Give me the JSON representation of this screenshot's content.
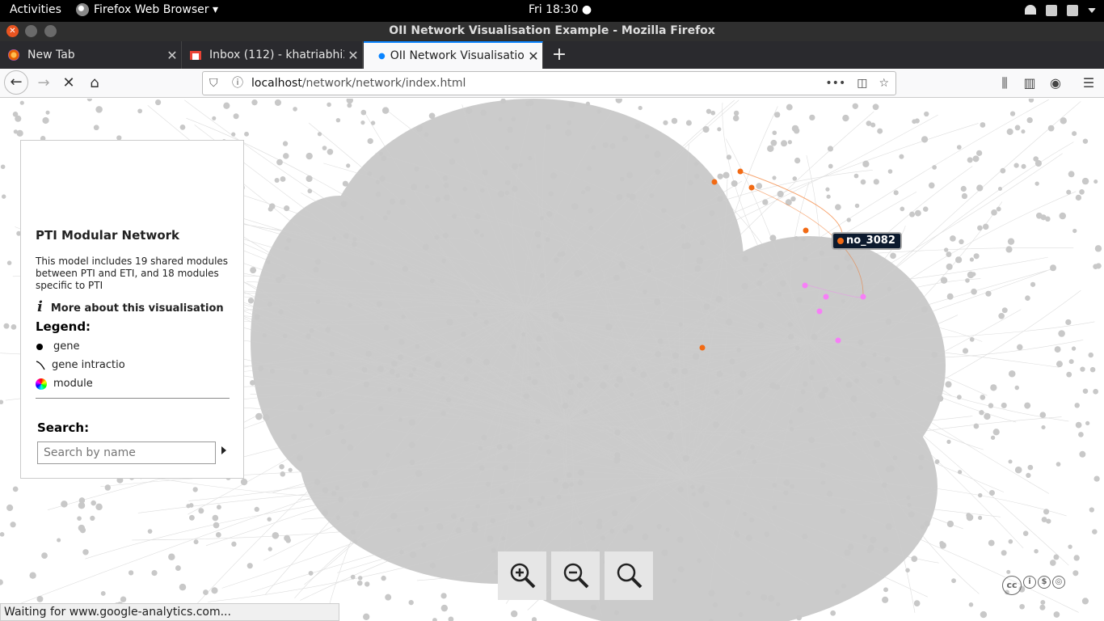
{
  "topbar": {
    "activities": "Activities",
    "app": "Firefox Web Browser ▾",
    "clock": "Fri 18:30 ●"
  },
  "window": {
    "title": "OII Network Visualisation Example - Mozilla Firefox"
  },
  "tabs": [
    {
      "label": "New Tab"
    },
    {
      "label": "Inbox (112) - khatriabhi2"
    },
    {
      "label": "OII Network Visualisatio"
    }
  ],
  "url": {
    "host": "localhost",
    "path": "/network/network/index.html"
  },
  "panel": {
    "title": "PTI Modular Network",
    "description": "This model includes 19 shared modules between PTI and ETI, and 18 modules specific to PTI",
    "more": "More about this visualisation",
    "legend_title": "Legend:",
    "legend": [
      {
        "label": "gene"
      },
      {
        "label": "gene intractio"
      },
      {
        "label": "module"
      }
    ],
    "search_title": "Search:",
    "search_placeholder": "Search by name"
  },
  "tooltip": {
    "label": "no_3082"
  },
  "status": "Waiting for www.google-analytics.com...",
  "colors": {
    "highlight_orange": "#f26a14",
    "highlight_pink": "#f77ff7",
    "node_gray": "#c8c8c8"
  },
  "icons": [
    "zoom-in-icon",
    "zoom-out-icon",
    "zoom-reset-icon"
  ]
}
